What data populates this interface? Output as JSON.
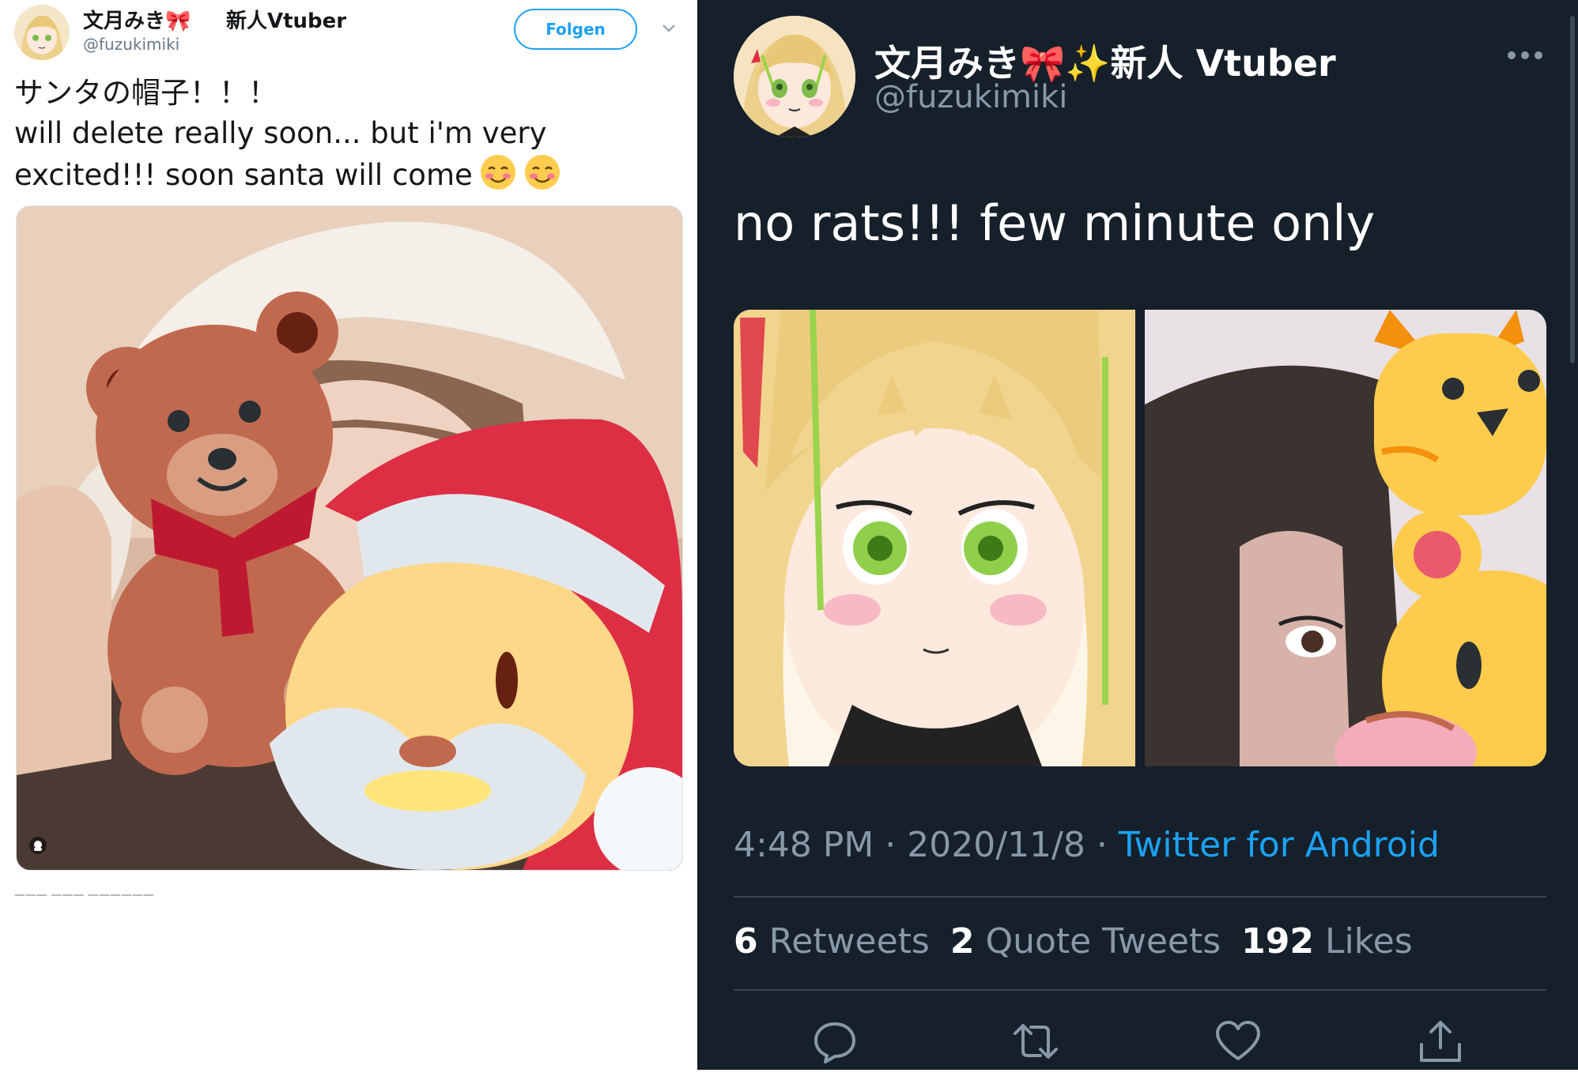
{
  "left_tweet": {
    "display_name": "文月みき🎀",
    "name_suffix": "新人Vtuber",
    "handle": "@fuzukimiki",
    "follow_label": "Folgen",
    "text_line1": "サンタの帽子！！！",
    "text_line2": "will delete really soon... but i'm very",
    "text_line3": "excited!!! soon santa will come",
    "icons": [
      "avatar",
      "chevron-down-icon",
      "smiling-face-emoji",
      "teddy-bear-sticker",
      "santa-sticker",
      "media-badge-icon"
    ]
  },
  "right_tweet": {
    "display_name": "文月みき🎀✨新人 Vtuber",
    "handle": "@fuzukimiki",
    "text": "no rats!!! few minute only",
    "time": "4:48 PM",
    "sep1": " · ",
    "date": "2020/11/8",
    "sep2": " · ",
    "source": "Twitter for Android",
    "retweets_count": "6",
    "retweets_label": "Retweets",
    "quotes_count": "2",
    "quotes_label": "Quote Tweets",
    "likes_count": "192",
    "likes_label": "Likes",
    "icons": [
      "more-icon",
      "reply-icon",
      "retweet-icon",
      "like-icon",
      "share-icon"
    ]
  },
  "colors": {
    "dark_bg": "#15202b",
    "link_blue": "#1da1f2",
    "muted_gray": "#8899a6",
    "divider": "#38444d"
  }
}
